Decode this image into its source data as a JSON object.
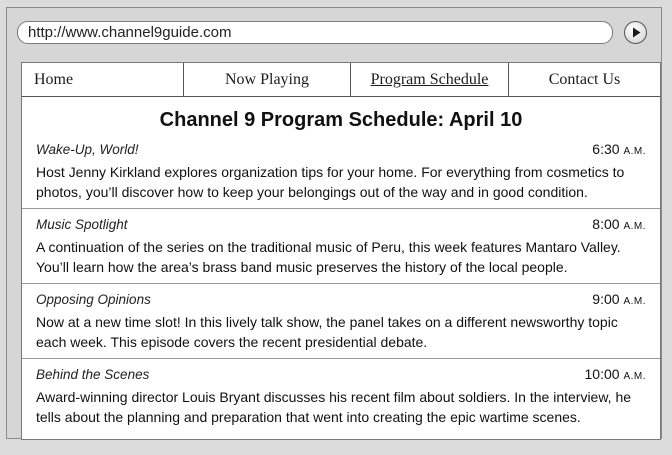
{
  "browser": {
    "url": "http://www.channel9guide.com"
  },
  "nav": {
    "items": [
      {
        "label": "Home"
      },
      {
        "label": "Now Playing"
      },
      {
        "label": "Program Schedule"
      },
      {
        "label": "Contact Us"
      }
    ],
    "active": "Program Schedule"
  },
  "page_title": "Channel 9 Program Schedule: April 10",
  "programs": [
    {
      "name": "Wake-Up, World!",
      "time": "6:30",
      "meridiem": "A.M.",
      "description": "Host Jenny Kirkland explores organization tips for your home. For everything from cosmetics to photos, you’ll discover how to keep your belongings out of the way and in good condition."
    },
    {
      "name": "Music Spotlight",
      "time": "8:00",
      "meridiem": "A.M.",
      "description": "A continuation of the series on the traditional music of Peru, this week features Mantaro Valley. You’ll learn how the area’s brass band music preserves the history of the local people."
    },
    {
      "name": "Opposing Opinions",
      "time": "9:00",
      "meridiem": "A.M.",
      "description": "Now at a new time slot! In this lively talk show, the panel takes on a different newsworthy topic each week. This episode covers the recent presidential debate."
    },
    {
      "name": "Behind the Scenes",
      "time": "10:00",
      "meridiem": "A.M.",
      "description": "Award-winning director Louis Bryant discusses his recent film about soldiers. In the interview, he tells about the planning and preparation that went into creating the epic wartime scenes."
    }
  ]
}
